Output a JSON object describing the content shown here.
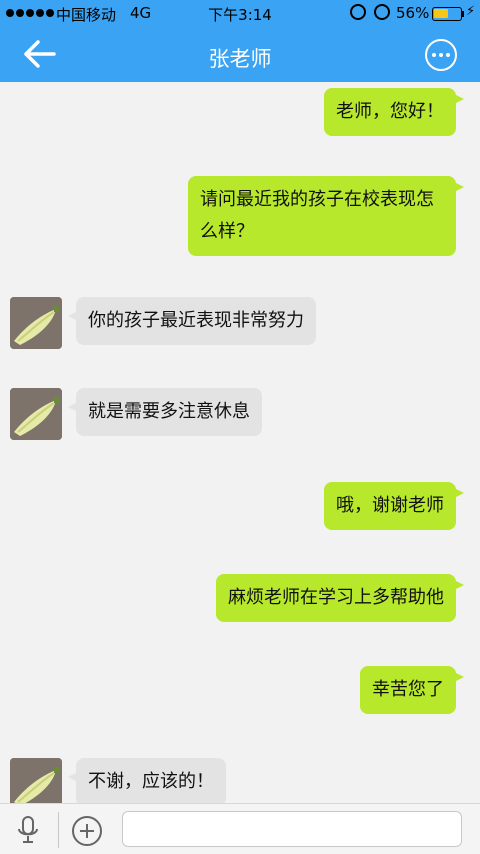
{
  "status_bar": {
    "carrier": "中国移动",
    "network": "4G",
    "time": "下午3:14",
    "battery_text": "56%",
    "battery_level": 0.56,
    "battery_color": "#f5c518"
  },
  "nav": {
    "title": "张老师",
    "back_icon": "arrow-left-icon",
    "more_icon": "more-circle-icon",
    "bar_color": "#3aa3f4"
  },
  "messages": [
    {
      "side": "right",
      "text": "老师，您好！"
    },
    {
      "side": "right",
      "text": "请问最近我的孩子在校表现怎么样？"
    },
    {
      "side": "left",
      "text": "你的孩子最近表现非常努力"
    },
    {
      "side": "left",
      "text": "就是需要多注意休息"
    },
    {
      "side": "right",
      "text": "哦，谢谢老师"
    },
    {
      "side": "right",
      "text": "麻烦老师在学习上多帮助他"
    },
    {
      "side": "right",
      "text": "幸苦您了"
    },
    {
      "side": "left",
      "text": "不谢，应该的！"
    }
  ],
  "colors": {
    "outgoing_bubble": "#b8e82c",
    "incoming_bubble": "#e3e3e3",
    "chat_background": "#f2f2f2"
  },
  "toolbar": {
    "voice_icon": "microphone-icon",
    "add_icon": "plus-circle-icon",
    "input_value": ""
  }
}
